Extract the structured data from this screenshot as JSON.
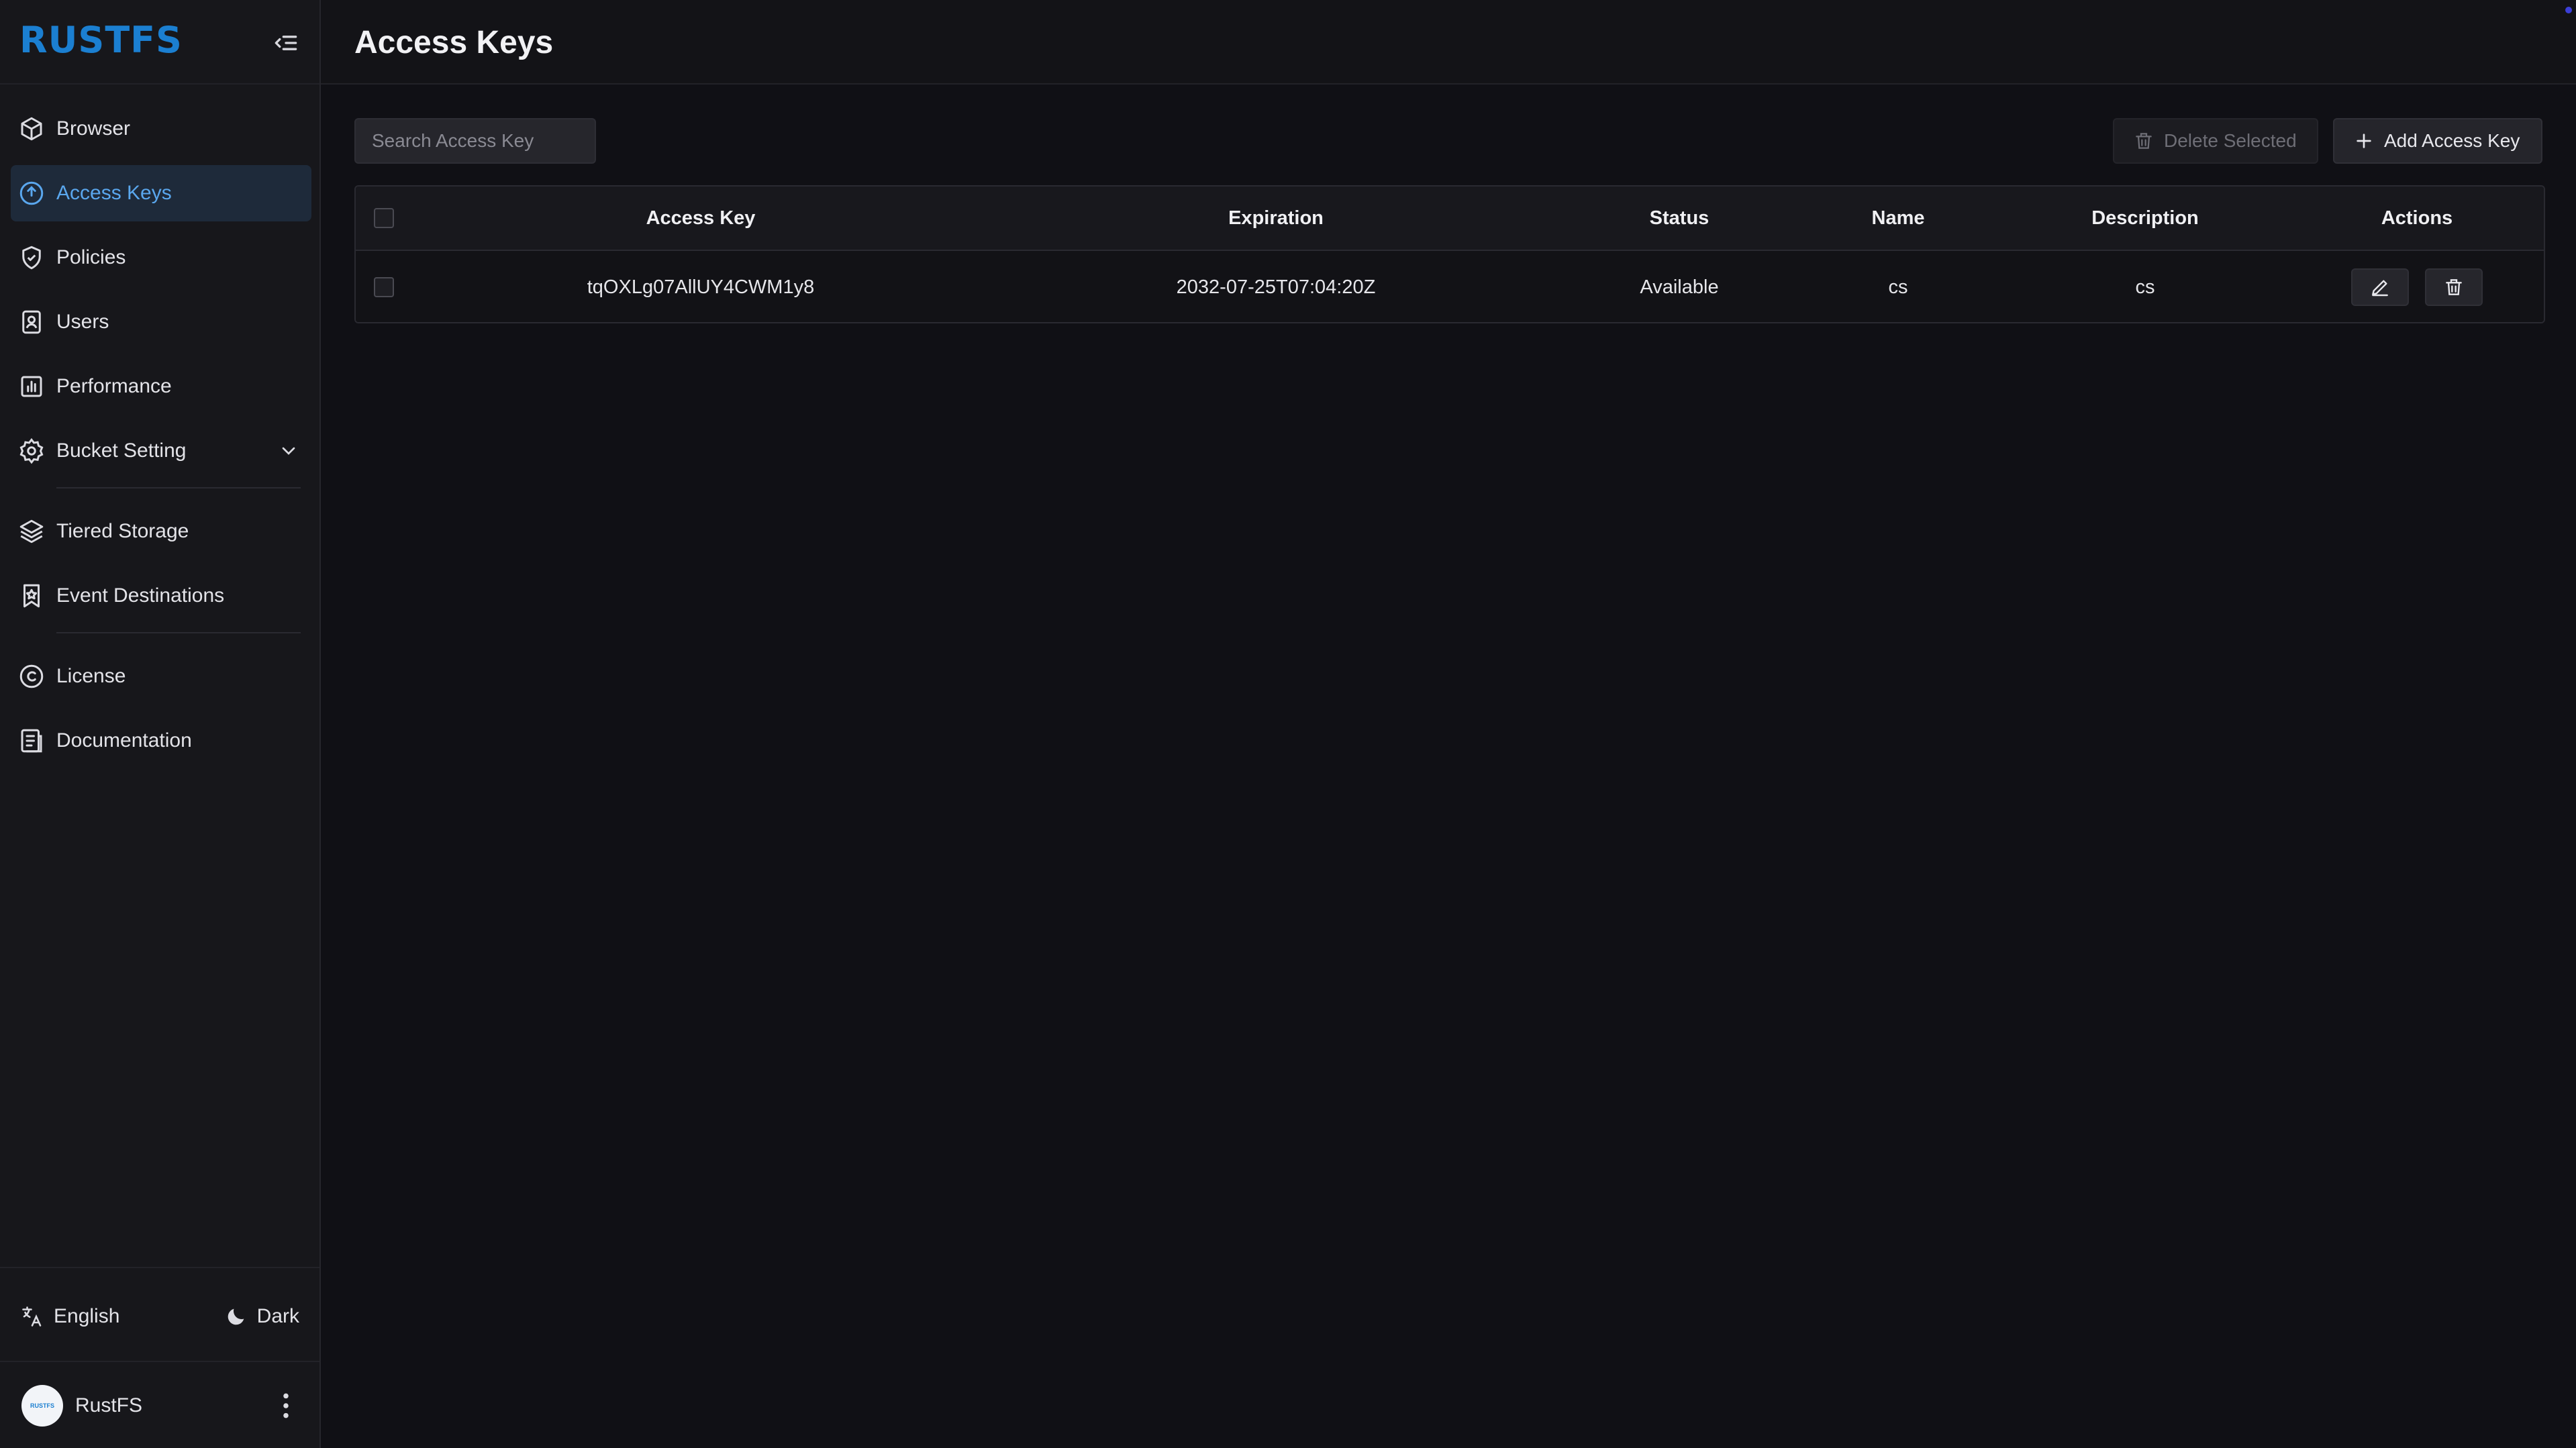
{
  "brand": {
    "name": "RUSTFS"
  },
  "sidebar": {
    "items": [
      {
        "label": "Browser",
        "icon": "cube-icon"
      },
      {
        "label": "Access Keys",
        "icon": "key-circle-icon",
        "active": true
      },
      {
        "label": "Policies",
        "icon": "shield-check-icon"
      },
      {
        "label": "Users",
        "icon": "user-badge-icon"
      },
      {
        "label": "Performance",
        "icon": "bar-chart-icon"
      },
      {
        "label": "Bucket Setting",
        "icon": "gear-icon",
        "expandable": true
      },
      {
        "label": "Tiered Storage",
        "icon": "layers-icon"
      },
      {
        "label": "Event Destinations",
        "icon": "bookmark-star-icon"
      },
      {
        "label": "License",
        "icon": "copyright-icon"
      },
      {
        "label": "Documentation",
        "icon": "document-icon"
      }
    ],
    "language": "English",
    "theme": "Dark",
    "user": {
      "name": "RustFS",
      "avatar_text": "RUSTFS"
    }
  },
  "header": {
    "title": "Access Keys"
  },
  "toolbar": {
    "search_placeholder": "Search Access Key",
    "delete_label": "Delete Selected",
    "add_label": "Add Access Key"
  },
  "table": {
    "columns": [
      "Access Key",
      "Expiration",
      "Status",
      "Name",
      "Description",
      "Actions"
    ],
    "rows": [
      {
        "access_key": "tqOXLg07AllUY4CWM1y8",
        "expiration": "2032-07-25T07:04:20Z",
        "status": "Available",
        "name": "cs",
        "description": "cs"
      }
    ]
  },
  "colors": {
    "accent": "#1b7fd1",
    "active_text": "#5aa7ee",
    "active_bg": "#1e2a3a",
    "background": "#101015",
    "sidebar": "#17171b"
  }
}
